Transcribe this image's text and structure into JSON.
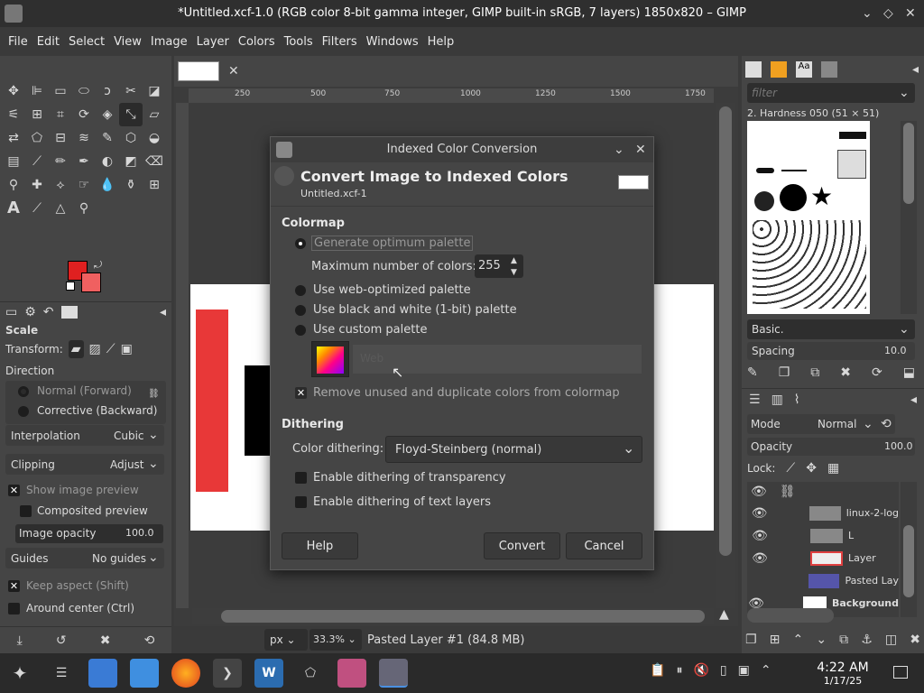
{
  "window": {
    "title": "*Untitled.xcf-1.0 (RGB color 8-bit gamma integer, GIMP built-in sRGB, 7 layers) 1850x820 – GIMP"
  },
  "menu": [
    "File",
    "Edit",
    "Select",
    "View",
    "Image",
    "Layer",
    "Colors",
    "Tools",
    "Filters",
    "Windows",
    "Help"
  ],
  "tool_options": {
    "title": "Scale",
    "transform_label": "Transform:",
    "direction_label": "Direction",
    "direction_normal": "Normal (Forward)",
    "direction_corrective": "Corrective (Backward)",
    "interpolation_label": "Interpolation",
    "interpolation_value": "Cubic",
    "clipping_label": "Clipping",
    "clipping_value": "Adjust",
    "show_preview": "Show image preview",
    "composited_preview": "Composited preview",
    "image_opacity_label": "Image opacity",
    "image_opacity_value": "100.0",
    "guides_label": "Guides",
    "guides_value": "No guides",
    "keep_aspect": "Keep aspect (Shift)",
    "around_center": "Around center (Ctrl)"
  },
  "ruler": {
    "ticks": [
      "250",
      "500",
      "750",
      "1000",
      "1250",
      "1500",
      "1750"
    ]
  },
  "statusbar": {
    "unit": "px",
    "zoom": "33.3%",
    "message": "Pasted Layer #1 (84.8 MB)"
  },
  "dialog": {
    "title": "Indexed Color Conversion",
    "heading": "Convert Image to Indexed Colors",
    "subheading": "Untitled.xcf-1",
    "colormap_label": "Colormap",
    "opt_generate": "Generate optimum palette",
    "max_colors_label": "Maximum number of colors:",
    "max_colors_value": "255",
    "opt_web": "Use web-optimized palette",
    "opt_bw": "Use black and white (1-bit) palette",
    "opt_custom": "Use custom palette",
    "custom_palette_name": "Web",
    "remove_unused": "Remove unused and duplicate colors from colormap",
    "dithering_label": "Dithering",
    "color_dithering_label": "Color dithering:",
    "color_dithering_value": "Floyd-Steinberg (normal)",
    "dither_transparency": "Enable dithering of transparency",
    "dither_text": "Enable dithering of text layers",
    "btn_help": "Help",
    "btn_convert": "Convert",
    "btn_cancel": "Cancel"
  },
  "brushes": {
    "filter_placeholder": "filter",
    "current_brush": "2. Hardness 050 (51 × 51)",
    "preset": "Basic.",
    "spacing_label": "Spacing",
    "spacing_value": "10.0"
  },
  "layers": {
    "mode_label": "Mode",
    "mode_value": "Normal",
    "opacity_label": "Opacity",
    "opacity_value": "100.0",
    "lock_label": "Lock:",
    "items": [
      "linux-2-log",
      "L",
      "Layer",
      "Pasted Lay",
      "Background"
    ]
  },
  "taskbar": {
    "time": "4:22 AM",
    "date": "1/17/25"
  },
  "colors": {
    "fg": "#e02020",
    "bg": "#f06060",
    "accent": "#ffffff"
  }
}
